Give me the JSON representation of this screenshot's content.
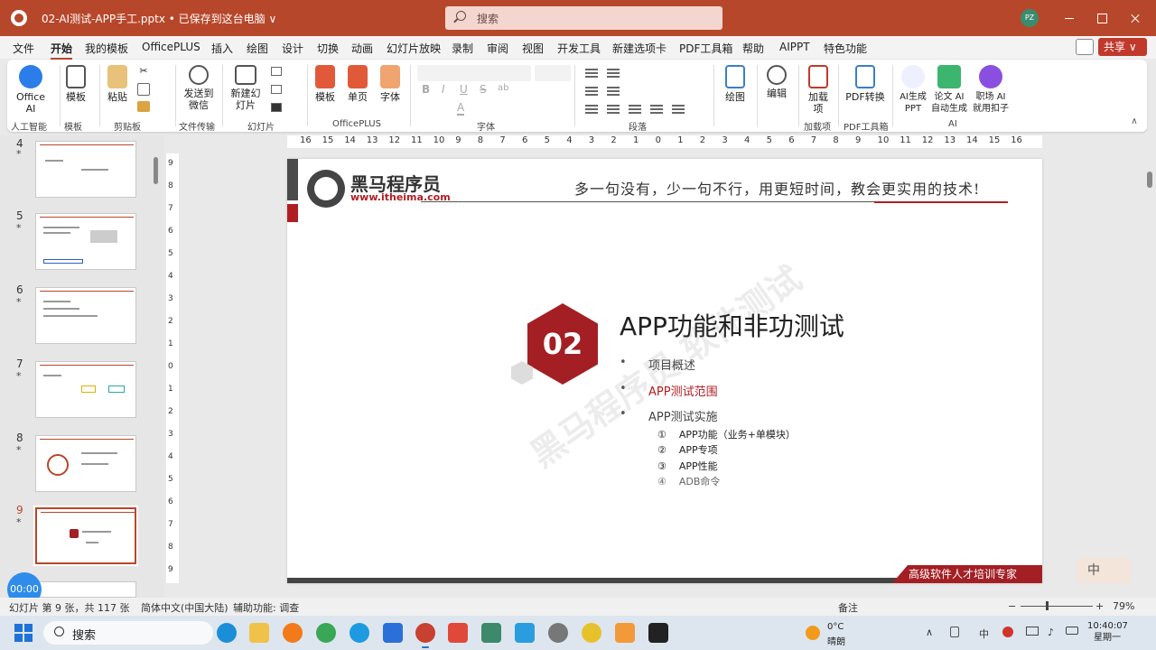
{
  "titlebar": {
    "doc_title": "02-AI测试-APP手工.pptx • 已保存到这台电脑 ∨",
    "search_placeholder": "搜索",
    "avatar_initials": "PZ"
  },
  "menu": {
    "tabs": [
      "文件",
      "开始",
      "我的模板",
      "OfficePLUS",
      "插入",
      "绘图",
      "设计",
      "切换",
      "动画",
      "幻灯片放映",
      "录制",
      "审阅",
      "视图",
      "开发工具",
      "新建选项卡",
      "PDF工具箱",
      "帮助",
      "AIPPT",
      "特色功能"
    ],
    "active_tab": "开始",
    "share_label": "共享 ∨"
  },
  "ribbon": {
    "buttons": {
      "office_ai": "Office AI",
      "template": "模板",
      "paste": "粘贴",
      "send_wechat": "发送到微信",
      "new_slide": "新建幻灯片",
      "templates2": "模板",
      "single_page": "单页",
      "font_btn": "字体",
      "draw": "绘图",
      "edit": "编辑",
      "addins": "加载项",
      "pdf_convert": "PDF转换",
      "ai_ppt": "AI生成PPT",
      "paper_ai": "论文 AI 自动生成",
      "career_ai": "职场 AI 就用扣子"
    },
    "groups": {
      "ai_intel": "人工智能",
      "template": "模板",
      "clipboard": "剪贴板",
      "file_transfer": "文件传输",
      "slides": "幻灯片",
      "officeplus": "OfficePLUS",
      "font": "字体",
      "paragraph": "段落",
      "addins": "加载项",
      "pdf_tools": "PDF工具箱",
      "ai": "AI"
    },
    "font_format": [
      "B",
      "I",
      "U",
      "S",
      "ab",
      "A"
    ]
  },
  "thumbnails": {
    "slides": [
      {
        "num": "4",
        "star": "*"
      },
      {
        "num": "5",
        "star": "*"
      },
      {
        "num": "6",
        "star": "*"
      },
      {
        "num": "7",
        "star": "*"
      },
      {
        "num": "8",
        "star": "*"
      },
      {
        "num": "9",
        "star": "*"
      }
    ],
    "current": "9"
  },
  "ruler": {
    "h_ticks": [
      "16",
      "15",
      "14",
      "13",
      "12",
      "11",
      "10",
      "9",
      "8",
      "7",
      "6",
      "5",
      "4",
      "3",
      "2",
      "1",
      "0",
      "1",
      "2",
      "3",
      "4",
      "5",
      "6",
      "7",
      "8",
      "9",
      "10",
      "11",
      "12",
      "13",
      "14",
      "15",
      "16"
    ],
    "v_ticks": [
      "9",
      "8",
      "7",
      "6",
      "5",
      "4",
      "3",
      "2",
      "1",
      "0",
      "1",
      "2",
      "3",
      "4",
      "5",
      "6",
      "7",
      "8",
      "9"
    ]
  },
  "slide": {
    "logo_text": "黑马程序员",
    "logo_url": "www.itheima.com",
    "slogan": "多一句没有，少一句不行，用更短时间，教会更实用的技术!",
    "section_number": "02",
    "title": "APP功能和非功测试",
    "bullets": [
      {
        "text": "项目概述",
        "active": false
      },
      {
        "text": "APP测试范围",
        "active": true
      },
      {
        "text": "APP测试实施",
        "active": false
      }
    ],
    "subitems": [
      {
        "mark": "①",
        "text": "APP功能（业务+单模块）",
        "dim": false
      },
      {
        "mark": "②",
        "text": "APP专项",
        "dim": false
      },
      {
        "mark": "③",
        "text": "APP性能",
        "dim": false
      },
      {
        "mark": "④",
        "text": "ADB命令",
        "dim": true
      }
    ],
    "watermark": "黑马程序员 软件测试",
    "footer_tag": "高级软件人才培训专家"
  },
  "overlay": {
    "ime": "中",
    "timer": "00:00"
  },
  "statusbar": {
    "slide_info": "幻灯片 第 9 张，共 117 张",
    "language": "简体中文(中国大陆)",
    "accessibility": "辅助功能: 调查",
    "notes": "备注",
    "zoom_minus": "−",
    "zoom_plus": "+",
    "zoom": "79%"
  },
  "taskbar": {
    "search_placeholder": "搜索",
    "weather_temp": "0°C",
    "weather_desc": "晴朗",
    "ime_tray": "中",
    "time": "10:40:07",
    "weekday": "星期一"
  },
  "colors": {
    "accent_title": "#b7472a",
    "brand_red": "#a31f24",
    "slide_dark": "#444444"
  }
}
